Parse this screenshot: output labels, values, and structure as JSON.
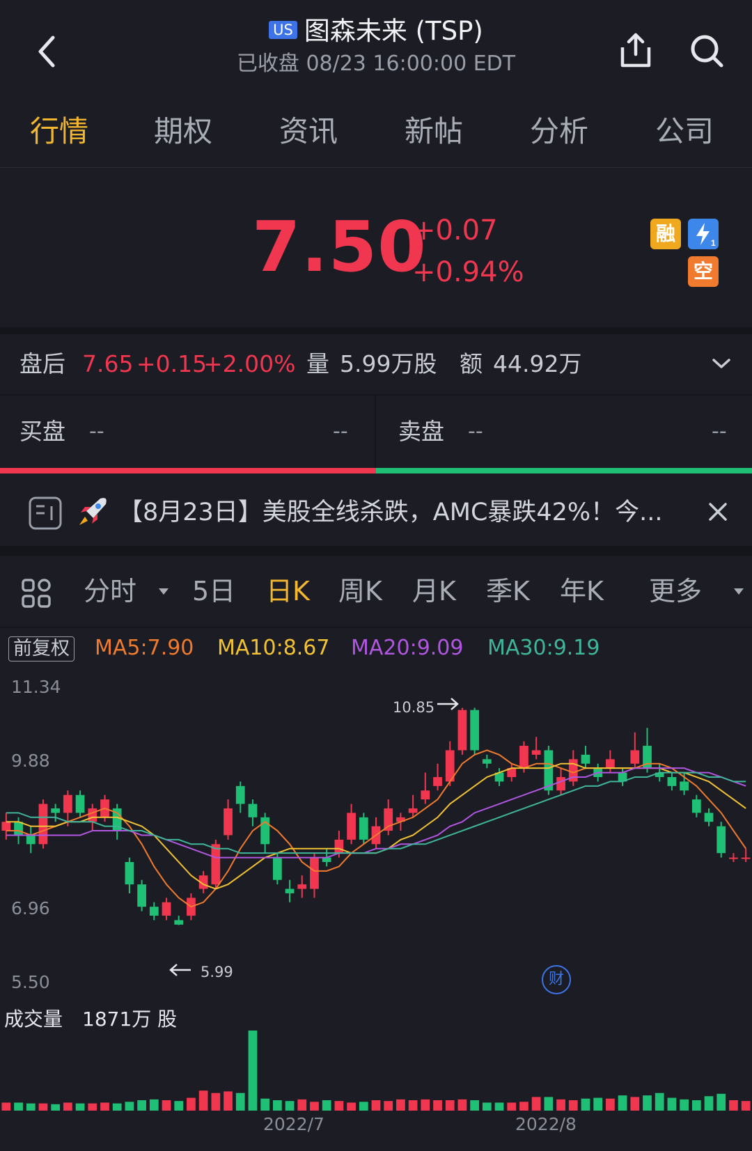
{
  "header": {
    "market_badge": "US",
    "title": "图森未来 (TSP)",
    "status": "已收盘 08/23 16:00:00 EDT",
    "icons": [
      "back-arrow-icon",
      "share-icon",
      "search-icon"
    ]
  },
  "tabs": [
    {
      "label": "行情",
      "active": true
    },
    {
      "label": "期权",
      "active": false
    },
    {
      "label": "资讯",
      "active": false
    },
    {
      "label": "新帖",
      "active": false
    },
    {
      "label": "分析",
      "active": false
    },
    {
      "label": "公司",
      "active": false
    }
  ],
  "quote": {
    "price": "7.50",
    "change": "+0.07",
    "change_pct": "+0.94%",
    "badges": [
      "融",
      "空"
    ],
    "colors": {
      "up": "#f1364f",
      "down": "#1fbf75"
    }
  },
  "after_hours": {
    "label": "盘后",
    "price": "7.65",
    "change": "+0.15",
    "change_pct": "+2.00%",
    "volume_label": "量",
    "volume": "5.99万股",
    "amount_label": "额",
    "amount": "44.92万"
  },
  "order_book": {
    "bid_label": "买盘",
    "bid_price": "--",
    "bid_size": "--",
    "ask_label": "卖盘",
    "ask_price": "--",
    "ask_size": "--"
  },
  "news": {
    "text": "【8月23日】美股全线杀跌，AMC暴跌42%！今..."
  },
  "periods": {
    "items": [
      "分时",
      "5日",
      "日K",
      "周K",
      "月K",
      "季K",
      "年K",
      "更多"
    ],
    "active": "日K"
  },
  "ma": {
    "adjust_label": "前复权",
    "ma5": "MA5:7.90",
    "ma10": "MA10:8.67",
    "ma20": "MA20:9.09",
    "ma30": "MA30:9.19",
    "colors": {
      "ma5": "#f07a2e",
      "ma10": "#f2c233",
      "ma20": "#b056e0",
      "ma30": "#3fb59a"
    }
  },
  "volume": {
    "label": "成交量",
    "value": "1871万 股"
  },
  "chart_data": {
    "type": "candlestick",
    "y_ticks": [
      "11.34",
      "9.88",
      "6.96",
      "5.50"
    ],
    "ylim": [
      5.5,
      11.34
    ],
    "x_ticks": [
      "2022/7",
      "2022/8"
    ],
    "high_marker": "10.85",
    "low_marker": "5.99",
    "event_marker": "财",
    "candles": [
      {
        "o": 8.1,
        "c": 8.3,
        "h": 8.5,
        "l": 7.9
      },
      {
        "o": 8.3,
        "c": 8.0,
        "h": 8.4,
        "l": 7.8
      },
      {
        "o": 8.0,
        "c": 7.8,
        "h": 8.2,
        "l": 7.6
      },
      {
        "o": 7.8,
        "c": 8.7,
        "h": 8.8,
        "l": 7.7
      },
      {
        "o": 8.6,
        "c": 8.5,
        "h": 8.7,
        "l": 8.3
      },
      {
        "o": 8.5,
        "c": 8.9,
        "h": 9.0,
        "l": 8.2
      },
      {
        "o": 8.9,
        "c": 8.5,
        "h": 9.0,
        "l": 8.4
      },
      {
        "o": 8.3,
        "c": 8.6,
        "h": 8.7,
        "l": 8.1
      },
      {
        "o": 8.4,
        "c": 8.8,
        "h": 8.9,
        "l": 8.3
      },
      {
        "o": 8.6,
        "c": 8.1,
        "h": 8.7,
        "l": 7.9
      },
      {
        "o": 7.4,
        "c": 6.9,
        "h": 7.5,
        "l": 6.7
      },
      {
        "o": 6.9,
        "c": 6.4,
        "h": 7.0,
        "l": 6.3
      },
      {
        "o": 6.4,
        "c": 6.2,
        "h": 6.5,
        "l": 6.1
      },
      {
        "o": 6.2,
        "c": 6.5,
        "h": 6.6,
        "l": 6.1
      },
      {
        "o": 6.1,
        "c": 6.0,
        "h": 6.2,
        "l": 5.99
      },
      {
        "o": 6.2,
        "c": 6.6,
        "h": 6.7,
        "l": 6.1
      },
      {
        "o": 6.8,
        "c": 7.1,
        "h": 7.2,
        "l": 6.7
      },
      {
        "o": 6.9,
        "c": 7.8,
        "h": 7.9,
        "l": 6.8
      },
      {
        "o": 8.0,
        "c": 8.6,
        "h": 8.8,
        "l": 7.9
      },
      {
        "o": 9.1,
        "c": 8.7,
        "h": 9.2,
        "l": 8.5
      },
      {
        "o": 8.7,
        "c": 8.4,
        "h": 8.8,
        "l": 8.2
      },
      {
        "o": 8.4,
        "c": 7.8,
        "h": 8.5,
        "l": 7.6
      },
      {
        "o": 7.5,
        "c": 7.0,
        "h": 7.6,
        "l": 6.9
      },
      {
        "o": 6.8,
        "c": 6.7,
        "h": 7.0,
        "l": 6.5
      },
      {
        "o": 6.8,
        "c": 6.9,
        "h": 7.1,
        "l": 6.6
      },
      {
        "o": 6.8,
        "c": 7.5,
        "h": 7.6,
        "l": 6.6
      },
      {
        "o": 7.5,
        "c": 7.4,
        "h": 7.7,
        "l": 7.3
      },
      {
        "o": 7.6,
        "c": 7.9,
        "h": 8.1,
        "l": 7.5
      },
      {
        "o": 7.9,
        "c": 8.5,
        "h": 8.7,
        "l": 7.8
      },
      {
        "o": 8.4,
        "c": 7.9,
        "h": 8.5,
        "l": 7.8
      },
      {
        "o": 7.8,
        "c": 8.2,
        "h": 8.4,
        "l": 7.7
      },
      {
        "o": 8.1,
        "c": 8.6,
        "h": 8.8,
        "l": 8.0
      },
      {
        "o": 8.3,
        "c": 8.4,
        "h": 8.5,
        "l": 8.1
      },
      {
        "o": 8.5,
        "c": 8.6,
        "h": 8.9,
        "l": 8.4
      },
      {
        "o": 8.8,
        "c": 9.0,
        "h": 9.4,
        "l": 8.7
      },
      {
        "o": 9.1,
        "c": 9.3,
        "h": 9.6,
        "l": 9.0
      },
      {
        "o": 9.2,
        "c": 9.9,
        "h": 10.1,
        "l": 9.1
      },
      {
        "o": 9.9,
        "c": 10.8,
        "h": 10.85,
        "l": 9.8
      },
      {
        "o": 10.8,
        "c": 9.9,
        "h": 10.85,
        "l": 9.8
      },
      {
        "o": 9.7,
        "c": 9.6,
        "h": 9.8,
        "l": 9.5
      },
      {
        "o": 9.4,
        "c": 9.2,
        "h": 9.5,
        "l": 9.1
      },
      {
        "o": 9.3,
        "c": 9.5,
        "h": 9.6,
        "l": 9.2
      },
      {
        "o": 9.5,
        "c": 10.0,
        "h": 10.1,
        "l": 9.4
      },
      {
        "o": 9.8,
        "c": 9.9,
        "h": 10.2,
        "l": 9.7
      },
      {
        "o": 9.9,
        "c": 9.0,
        "h": 10.0,
        "l": 8.9
      },
      {
        "o": 9.0,
        "c": 9.3,
        "h": 9.5,
        "l": 8.9
      },
      {
        "o": 9.2,
        "c": 9.7,
        "h": 9.9,
        "l": 9.1
      },
      {
        "o": 9.8,
        "c": 9.6,
        "h": 10.0,
        "l": 9.5
      },
      {
        "o": 9.5,
        "c": 9.3,
        "h": 9.6,
        "l": 9.2
      },
      {
        "o": 9.5,
        "c": 9.7,
        "h": 9.9,
        "l": 9.4
      },
      {
        "o": 9.4,
        "c": 9.2,
        "h": 9.5,
        "l": 9.1
      },
      {
        "o": 9.6,
        "c": 9.9,
        "h": 10.3,
        "l": 9.5
      },
      {
        "o": 10.0,
        "c": 9.5,
        "h": 10.4,
        "l": 9.4
      },
      {
        "o": 9.4,
        "c": 9.3,
        "h": 9.6,
        "l": 9.2
      },
      {
        "o": 9.3,
        "c": 9.1,
        "h": 9.4,
        "l": 9.0
      },
      {
        "o": 9.2,
        "c": 9.0,
        "h": 9.4,
        "l": 8.9
      },
      {
        "o": 8.8,
        "c": 8.5,
        "h": 8.9,
        "l": 8.4
      },
      {
        "o": 8.5,
        "c": 8.3,
        "h": 8.6,
        "l": 8.2
      },
      {
        "o": 8.2,
        "c": 7.6,
        "h": 8.3,
        "l": 7.5
      },
      {
        "o": 7.5,
        "c": 7.5,
        "h": 7.6,
        "l": 7.4
      },
      {
        "o": 7.5,
        "c": 7.5,
        "h": 7.7,
        "l": 7.4
      }
    ],
    "ma_series": {
      "ma5": [
        8.1,
        8.1,
        8.0,
        8.1,
        8.2,
        8.3,
        8.4,
        8.5,
        8.6,
        8.5,
        8.2,
        7.8,
        7.3,
        6.9,
        6.6,
        6.4,
        6.5,
        6.8,
        7.2,
        7.7,
        8.1,
        8.3,
        8.1,
        7.8,
        7.4,
        7.2,
        7.2,
        7.3,
        7.6,
        7.8,
        8.0,
        8.2,
        8.3,
        8.4,
        8.6,
        8.8,
        9.2,
        9.6,
        9.8,
        9.9,
        9.8,
        9.6,
        9.5,
        9.6,
        9.6,
        9.5,
        9.4,
        9.5,
        9.5,
        9.5,
        9.5,
        9.5,
        9.6,
        9.6,
        9.5,
        9.3,
        9.1,
        8.8,
        8.5,
        8.1,
        7.7
      ],
      "ma10": [
        8.3,
        8.3,
        8.2,
        8.2,
        8.2,
        8.3,
        8.3,
        8.4,
        8.4,
        8.4,
        8.3,
        8.2,
        8.0,
        7.7,
        7.4,
        7.1,
        6.9,
        6.8,
        6.9,
        7.1,
        7.3,
        7.5,
        7.6,
        7.7,
        7.7,
        7.7,
        7.7,
        7.7,
        7.6,
        7.6,
        7.6,
        7.7,
        7.9,
        8.0,
        8.2,
        8.4,
        8.7,
        8.9,
        9.1,
        9.3,
        9.4,
        9.5,
        9.5,
        9.5,
        9.5,
        9.6,
        9.6,
        9.5,
        9.5,
        9.5,
        9.5,
        9.5,
        9.5,
        9.5,
        9.4,
        9.4,
        9.3,
        9.2,
        9.0,
        8.8,
        8.6
      ],
      "ma20": [
        8.0,
        8.0,
        8.0,
        8.0,
        8.0,
        8.0,
        8.0,
        8.1,
        8.1,
        8.1,
        8.1,
        8.0,
        8.0,
        7.9,
        7.8,
        7.7,
        7.6,
        7.5,
        7.5,
        7.5,
        7.5,
        7.5,
        7.5,
        7.5,
        7.5,
        7.5,
        7.5,
        7.6,
        7.6,
        7.6,
        7.7,
        7.7,
        7.8,
        7.8,
        7.9,
        8.0,
        8.2,
        8.3,
        8.5,
        8.6,
        8.7,
        8.8,
        8.9,
        9.0,
        9.1,
        9.2,
        9.3,
        9.3,
        9.4,
        9.4,
        9.4,
        9.5,
        9.5,
        9.5,
        9.5,
        9.5,
        9.4,
        9.4,
        9.3,
        9.2,
        9.1
      ],
      "ma30": [
        8.5,
        8.5,
        8.4,
        8.4,
        8.4,
        8.3,
        8.3,
        8.3,
        8.2,
        8.2,
        8.1,
        8.1,
        8.0,
        7.9,
        7.9,
        7.8,
        7.8,
        7.7,
        7.7,
        7.6,
        7.6,
        7.6,
        7.6,
        7.6,
        7.6,
        7.6,
        7.6,
        7.6,
        7.6,
        7.6,
        7.6,
        7.7,
        7.7,
        7.8,
        7.8,
        7.9,
        8.0,
        8.1,
        8.2,
        8.3,
        8.4,
        8.5,
        8.6,
        8.7,
        8.8,
        8.9,
        9.0,
        9.1,
        9.1,
        9.2,
        9.2,
        9.3,
        9.3,
        9.4,
        9.4,
        9.4,
        9.4,
        9.3,
        9.3,
        9.2,
        9.2
      ]
    },
    "volumes": [
      10,
      10,
      9,
      9,
      8,
      10,
      9,
      9,
      10,
      9,
      11,
      13,
      14,
      13,
      12,
      16,
      25,
      22,
      24,
      22,
      100,
      15,
      13,
      12,
      14,
      11,
      13,
      12,
      10,
      11,
      13,
      12,
      14,
      13,
      14,
      13,
      13,
      14,
      13,
      10,
      10,
      10,
      11,
      17,
      17,
      14,
      13,
      15,
      16,
      15,
      19,
      17,
      19,
      22,
      16,
      14,
      13,
      18,
      21,
      13,
      12
    ]
  }
}
